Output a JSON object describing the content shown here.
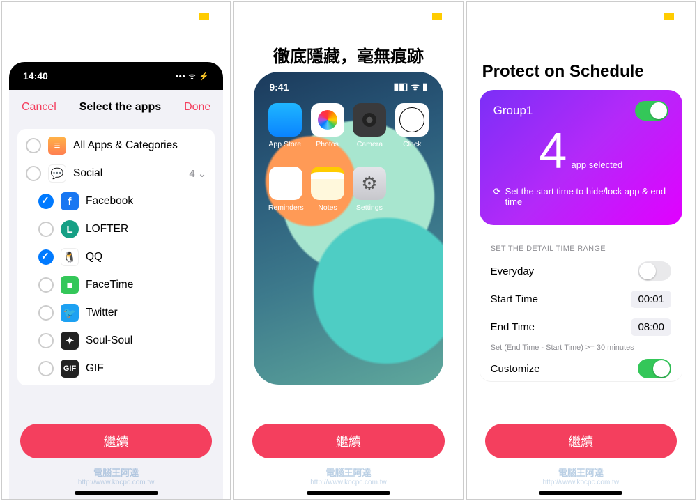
{
  "common": {
    "continue_label": "繼續",
    "watermark_title": "電腦王阿達",
    "watermark_url": "http://www.kocpc.com.tw"
  },
  "panel1": {
    "status_time": "14:40",
    "nav": {
      "cancel": "Cancel",
      "title": "Select the apps",
      "done": "Done"
    },
    "categories": {
      "all": "All Apps & Categories",
      "social": "Social",
      "social_count": "4"
    },
    "apps": [
      {
        "name": "Facebook",
        "checked": true,
        "icon": "fb"
      },
      {
        "name": "LOFTER",
        "checked": false,
        "icon": "lofter"
      },
      {
        "name": "QQ",
        "checked": true,
        "icon": "qq"
      },
      {
        "name": "FaceTime",
        "checked": false,
        "icon": "facetime"
      },
      {
        "name": "Twitter",
        "checked": false,
        "icon": "twitter"
      },
      {
        "name": "Soul-Soul",
        "checked": false,
        "icon": "soul"
      },
      {
        "name": "GIF",
        "checked": false,
        "icon": "gif"
      }
    ]
  },
  "panel2": {
    "title": "徹底隱藏，毫無痕跡",
    "status_time": "9:41",
    "apps_row1": [
      {
        "label": "App Store",
        "cls": "appstore"
      },
      {
        "label": "Photos",
        "cls": "photos"
      },
      {
        "label": "Camera",
        "cls": "camera"
      },
      {
        "label": "Clock",
        "cls": "clock"
      }
    ],
    "apps_row2": [
      {
        "label": "Reminders",
        "cls": "reminders"
      },
      {
        "label": "Notes",
        "cls": "notes"
      },
      {
        "label": "Settings",
        "cls": "settings"
      }
    ]
  },
  "panel3": {
    "title": "Protect on Schedule",
    "card": {
      "group": "Group1",
      "toggle_on": true,
      "count": "4",
      "count_label": "app selected",
      "hint": "Set the start time to hide/lock app & end time"
    },
    "schedule": {
      "header": "SET THE DETAIL TIME RANGE",
      "everyday_label": "Everyday",
      "everyday_on": false,
      "start_label": "Start Time",
      "start_value": "00:01",
      "end_label": "End Time",
      "end_value": "08:00",
      "hint": "Set (End Time - Start Time) >= 30 minutes",
      "customize_label": "Customize",
      "customize_on": true
    }
  }
}
